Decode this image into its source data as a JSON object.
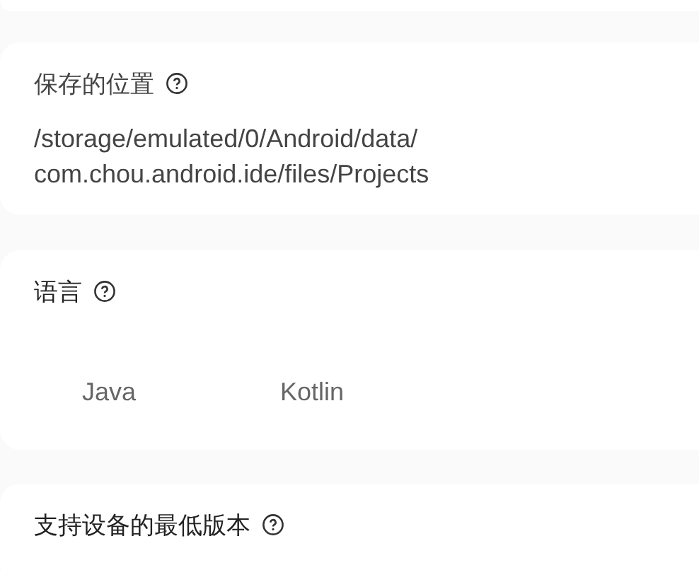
{
  "sections": [
    {
      "kind": "path",
      "title": "保存的位置",
      "value": "/storage/emulated/0/Android/data/\ncom.chou.android.ide/files/Projects"
    },
    {
      "kind": "options",
      "title": "语言",
      "options": [
        {
          "label": "Java"
        },
        {
          "label": "Kotlin"
        }
      ]
    },
    {
      "kind": "plain",
      "title": "支持设备的最低版本"
    }
  ]
}
